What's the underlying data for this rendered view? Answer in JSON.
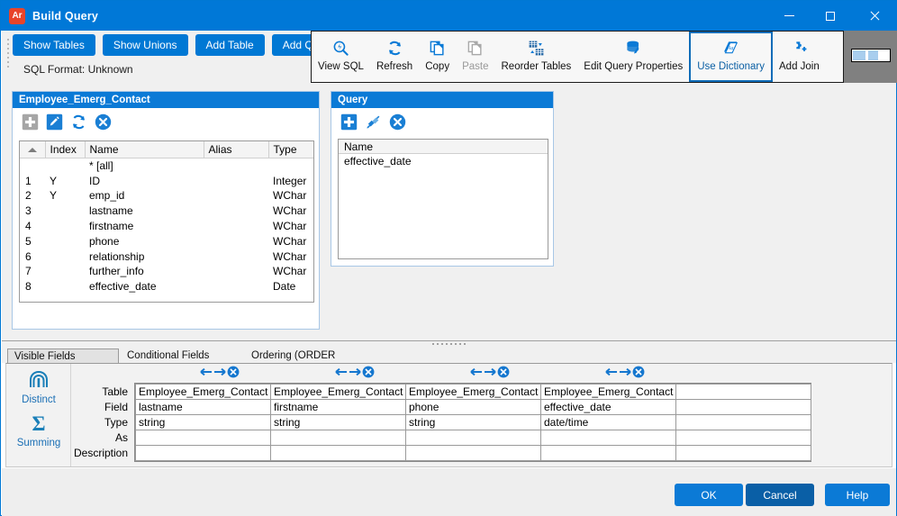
{
  "window": {
    "app_icon_text": "Ar",
    "title": "Build Query",
    "minimize": "minimize-icon",
    "maximize": "maximize-icon",
    "close": "close-icon"
  },
  "commandbar": {
    "buttons": [
      {
        "label": "Show Tables",
        "accel": "T"
      },
      {
        "label": "Show Unions",
        "accel": "U"
      },
      {
        "label": "Add Table",
        "accel": "A"
      },
      {
        "label": "Add Query",
        "accel": "Q"
      }
    ],
    "sql_format": "SQL Format: Unknown"
  },
  "toolbar": {
    "items": [
      {
        "label": "View SQL",
        "icon": "view-sql-icon",
        "disabled": false,
        "active": false
      },
      {
        "label": "Refresh",
        "icon": "refresh-icon",
        "disabled": false,
        "active": false
      },
      {
        "label": "Copy",
        "icon": "copy-icon",
        "disabled": false,
        "active": false
      },
      {
        "label": "Paste",
        "icon": "paste-icon",
        "disabled": true,
        "active": false
      },
      {
        "label": "Reorder Tables",
        "icon": "reorder-tables-icon",
        "disabled": false,
        "active": false
      },
      {
        "label": "Edit Query Properties",
        "icon": "edit-query-properties-icon",
        "disabled": false,
        "active": false
      },
      {
        "label": "Use Dictionary",
        "icon": "use-dictionary-icon",
        "disabled": false,
        "active": true
      },
      {
        "label": "Add Join",
        "icon": "add-join-icon",
        "disabled": false,
        "active": false
      }
    ]
  },
  "table_panel": {
    "title": "Employee_Emerg_Contact",
    "tools": [
      {
        "name": "add-field-button",
        "icon": "plus-icon",
        "disabled": true
      },
      {
        "name": "edit-field-button",
        "icon": "pencil-icon",
        "disabled": false
      },
      {
        "name": "refresh-fields-button",
        "icon": "refresh-icon",
        "disabled": false
      },
      {
        "name": "remove-field-button",
        "icon": "delete-icon",
        "disabled": false
      }
    ],
    "columns": [
      "",
      "Index",
      "Name",
      "Alias",
      "Type"
    ],
    "rows": [
      {
        "num": "",
        "index": "",
        "name": "* [all]",
        "alias": "",
        "type": ""
      },
      {
        "num": "1",
        "index": "Y",
        "name": "ID",
        "alias": "",
        "type": "Integer"
      },
      {
        "num": "2",
        "index": "Y",
        "name": "emp_id",
        "alias": "",
        "type": "WChar"
      },
      {
        "num": "3",
        "index": "",
        "name": "lastname",
        "alias": "",
        "type": "WChar"
      },
      {
        "num": "4",
        "index": "",
        "name": "firstname",
        "alias": "",
        "type": "WChar"
      },
      {
        "num": "5",
        "index": "",
        "name": "phone",
        "alias": "",
        "type": "WChar"
      },
      {
        "num": "6",
        "index": "",
        "name": "relationship",
        "alias": "",
        "type": "WChar"
      },
      {
        "num": "7",
        "index": "",
        "name": "further_info",
        "alias": "",
        "type": "WChar"
      },
      {
        "num": "8",
        "index": "",
        "name": "effective_date",
        "alias": "",
        "type": "Date"
      }
    ]
  },
  "query_panel": {
    "title": "Query",
    "tools": [
      {
        "name": "add-query-button",
        "icon": "plus-icon",
        "disabled": false
      },
      {
        "name": "edit-join-button",
        "icon": "join-icon",
        "disabled": false
      },
      {
        "name": "remove-query-button",
        "icon": "delete-icon",
        "disabled": false
      }
    ],
    "column_header": "Name",
    "rows": [
      "effective_date"
    ]
  },
  "tabs": [
    {
      "label": "Visible Fields (SELECT)",
      "selected": true
    },
    {
      "label": "Conditional Fields (WHERE)",
      "selected": false
    },
    {
      "label": "Ordering (ORDER BY)",
      "selected": false
    }
  ],
  "side_tools": [
    {
      "label": "Distinct",
      "icon": "distinct-fingerprint-icon"
    },
    {
      "label": "Summing",
      "icon": "summing-sigma-icon"
    }
  ],
  "field_grid": {
    "row_labels": [
      "Table",
      "Field",
      "Type",
      "As",
      "Description"
    ],
    "columns": [
      {
        "table": "Employee_Emerg_Contact",
        "field": "lastname",
        "type": "string",
        "as": "",
        "description": ""
      },
      {
        "table": "Employee_Emerg_Contact",
        "field": "firstname",
        "type": "string",
        "as": "",
        "description": ""
      },
      {
        "table": "Employee_Emerg_Contact",
        "field": "phone",
        "type": "string",
        "as": "",
        "description": ""
      },
      {
        "table": "Employee_Emerg_Contact",
        "field": "effective_date",
        "type": "date/time",
        "as": "",
        "description": ""
      },
      {
        "table": "",
        "field": "",
        "type": "",
        "as": "",
        "description": ""
      }
    ],
    "column_controls": {
      "move_left": "arrow-left-icon",
      "move_right": "arrow-right-icon",
      "remove": "delete-icon"
    }
  },
  "footer": {
    "ok": "OK",
    "cancel": "Cancel",
    "help": "Help"
  },
  "colors": {
    "accent": "#0078d4",
    "title_bar": "#0078d7",
    "panel_header": "#0b7ad6",
    "link": "#1a6fb5"
  }
}
